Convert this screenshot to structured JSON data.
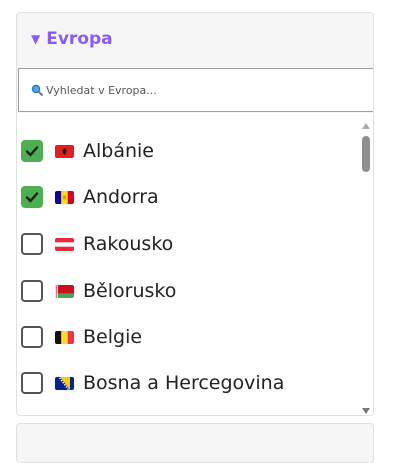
{
  "panel": {
    "title": "Evropa",
    "expanded_icon": "triangle-down-icon",
    "accent_color": "#8a5cf6"
  },
  "search": {
    "placeholder": "Vyhledat v Evropa...",
    "icon": "search-icon"
  },
  "countries": [
    {
      "label": "Albánie",
      "checked": true,
      "flag": "albania-flag-icon"
    },
    {
      "label": "Andorra",
      "checked": true,
      "flag": "andorra-flag-icon"
    },
    {
      "label": "Rakousko",
      "checked": false,
      "flag": "austria-flag-icon"
    },
    {
      "label": "Bělorusko",
      "checked": false,
      "flag": "belarus-flag-icon"
    },
    {
      "label": "Belgie",
      "checked": false,
      "flag": "belgium-flag-icon"
    },
    {
      "label": "Bosna a Hercegovina",
      "checked": false,
      "flag": "bosnia-flag-icon"
    }
  ],
  "colors": {
    "checked": "#4caf50"
  }
}
